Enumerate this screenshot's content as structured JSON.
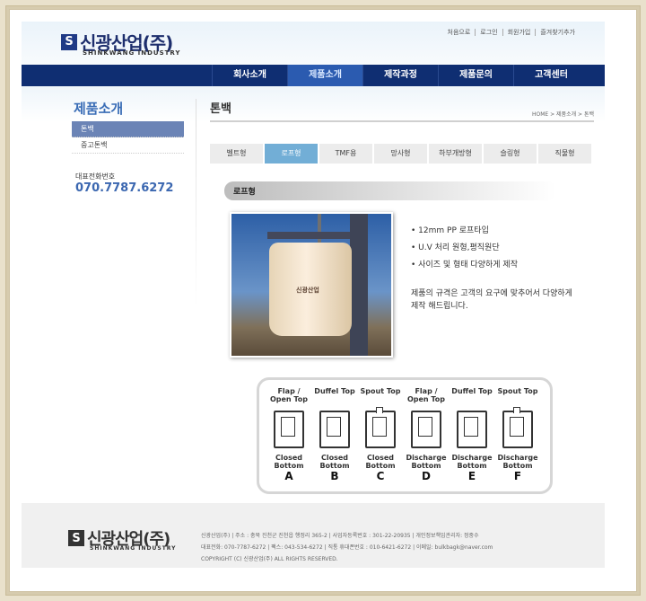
{
  "header": {
    "logo_mark": "S",
    "logo_text": "신광산업(주)",
    "logo_sub": "SHINKWANG INDUSTRY",
    "top_links": [
      "처음으로",
      "로그인",
      "회원가입",
      "즐겨찾기추가"
    ]
  },
  "nav": [
    "회사소개",
    "제품소개",
    "제작과정",
    "제품문의",
    "고객센터"
  ],
  "nav_active": "제품소개",
  "sidebar": {
    "title": "제품소개",
    "items": [
      "톤백",
      "중고톤백"
    ],
    "phone_label": "대표전화번호",
    "phone": "070.7787.6272"
  },
  "main": {
    "title": "톤백",
    "breadcrumb": "HOME > 제품소개 > 톤백",
    "tabs": [
      "벨트형",
      "로프형",
      "TMF용",
      "망사형",
      "하부개방형",
      "슬링형",
      "직물형"
    ],
    "active_tab": "로프형",
    "section_title": "로프형",
    "photo_label": "신광산업",
    "bullets": [
      "• 12mm PP 로프타입",
      "• U.V 처리 원형,평직원단",
      "• 사이즈 및 형태 다양하게 제작"
    ],
    "description": "제품의 규격은 고객의 요구에 맞추어서 다양하게 제작 해드립니다."
  },
  "diagram": [
    {
      "top": "Flap / Open Top",
      "bottom": "Closed Bottom",
      "letter": "A",
      "spout": false
    },
    {
      "top": "Duffel Top",
      "bottom": "Closed Bottom",
      "letter": "B",
      "spout": false
    },
    {
      "top": "Spout Top",
      "bottom": "Closed Bottom",
      "letter": "C",
      "spout": true
    },
    {
      "top": "Flap / Open Top",
      "bottom": "Discharge Bottom",
      "letter": "D",
      "spout": false
    },
    {
      "top": "Duffel Top",
      "bottom": "Discharge Bottom",
      "letter": "E",
      "spout": false
    },
    {
      "top": "Spout Top",
      "bottom": "Discharge Bottom",
      "letter": "F",
      "spout": true
    }
  ],
  "footer": {
    "logo_text": "신광산업(주)",
    "logo_sub": "SHINKWANG INDUSTRY",
    "line1": "신광산업(주)  |  주소 : 충북 진천군 진천읍 행정리 365-2  |  사업자등록번호 : 301-22-20935  |  개인정보책임관리자: 정중수",
    "line2": "대표전화: 070-7787-6272  |  팩스: 043-534-6272  |  직통 휴대폰번호 : 010-6421-6272  |  이메일: bulkbagk@naver.com",
    "line3": "COPYRIGHT (C) 신광산업(주) ALL RIGHTS RESERVED."
  },
  "colors": {
    "nav_bg": "#0f2e72",
    "accent_blue": "#3a6db6",
    "tab_active": "#72aed6"
  }
}
